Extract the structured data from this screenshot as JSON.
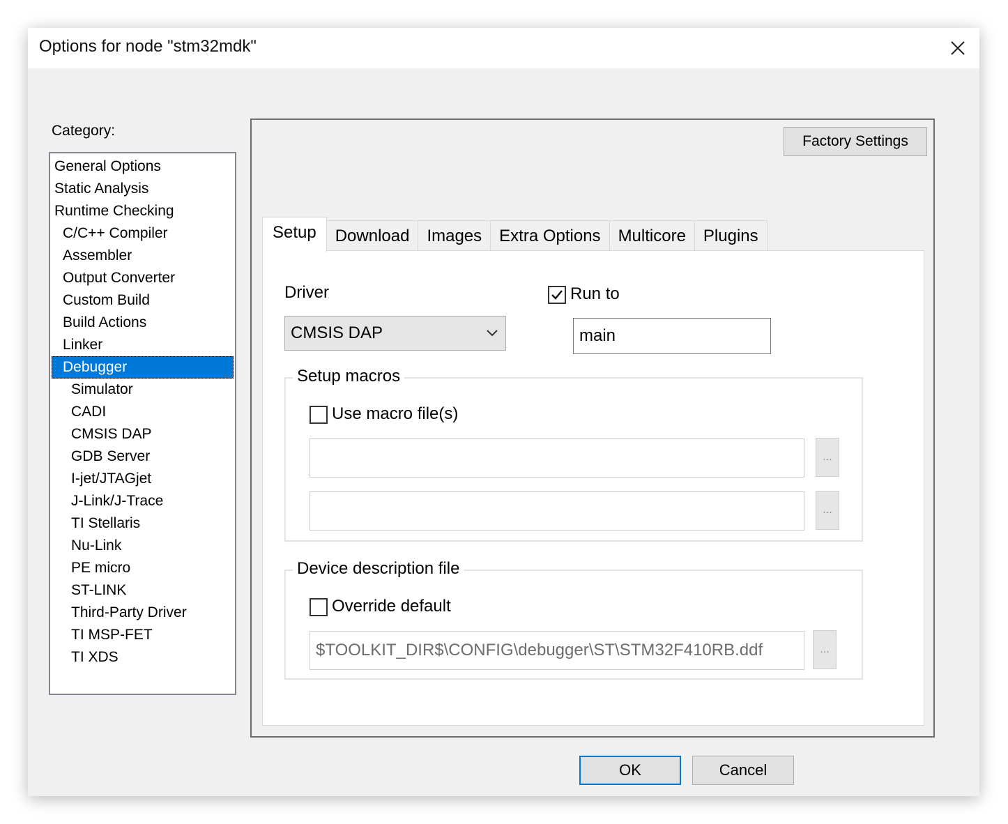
{
  "window": {
    "title": "Options for node \"stm32mdk\"",
    "close_icon": "close-icon"
  },
  "category": {
    "label": "Category:",
    "items": [
      {
        "label": "General Options",
        "level": 0
      },
      {
        "label": "Static Analysis",
        "level": 0
      },
      {
        "label": "Runtime Checking",
        "level": 0
      },
      {
        "label": "C/C++ Compiler",
        "level": 1
      },
      {
        "label": "Assembler",
        "level": 1
      },
      {
        "label": "Output Converter",
        "level": 1
      },
      {
        "label": "Custom Build",
        "level": 1
      },
      {
        "label": "Build Actions",
        "level": 1
      },
      {
        "label": "Linker",
        "level": 1
      },
      {
        "label": "Debugger",
        "level": 1,
        "selected": true
      },
      {
        "label": "Simulator",
        "level": 2
      },
      {
        "label": "CADI",
        "level": 2
      },
      {
        "label": "CMSIS DAP",
        "level": 2
      },
      {
        "label": "GDB Server",
        "level": 2
      },
      {
        "label": "I-jet/JTAGjet",
        "level": 2
      },
      {
        "label": "J-Link/J-Trace",
        "level": 2
      },
      {
        "label": "TI Stellaris",
        "level": 2
      },
      {
        "label": "Nu-Link",
        "level": 2
      },
      {
        "label": "PE micro",
        "level": 2
      },
      {
        "label": "ST-LINK",
        "level": 2
      },
      {
        "label": "Third-Party Driver",
        "level": 2
      },
      {
        "label": "TI MSP-FET",
        "level": 2
      },
      {
        "label": "TI XDS",
        "level": 2
      }
    ]
  },
  "factory_settings_label": "Factory Settings",
  "tabs": [
    {
      "label": "Setup",
      "active": true
    },
    {
      "label": "Download"
    },
    {
      "label": "Images"
    },
    {
      "label": "Extra Options"
    },
    {
      "label": "Multicore"
    },
    {
      "label": "Plugins"
    }
  ],
  "setup": {
    "driver_label": "Driver",
    "driver_value": "CMSIS DAP",
    "run_to_label": "Run to",
    "run_to_checked": true,
    "run_to_value": "main",
    "setup_macros": {
      "title": "Setup macros",
      "use_macro_label": "Use macro file(s)",
      "use_macro_checked": false,
      "macro_file_1": "",
      "macro_file_2": "",
      "browse_label": "..."
    },
    "device_description": {
      "title": "Device description file",
      "override_label": "Override default",
      "override_checked": false,
      "ddf_path": "$TOOLKIT_DIR$\\CONFIG\\debugger\\ST\\STM32F410RB.ddf",
      "browse_label": "..."
    }
  },
  "buttons": {
    "ok": "OK",
    "cancel": "Cancel"
  }
}
